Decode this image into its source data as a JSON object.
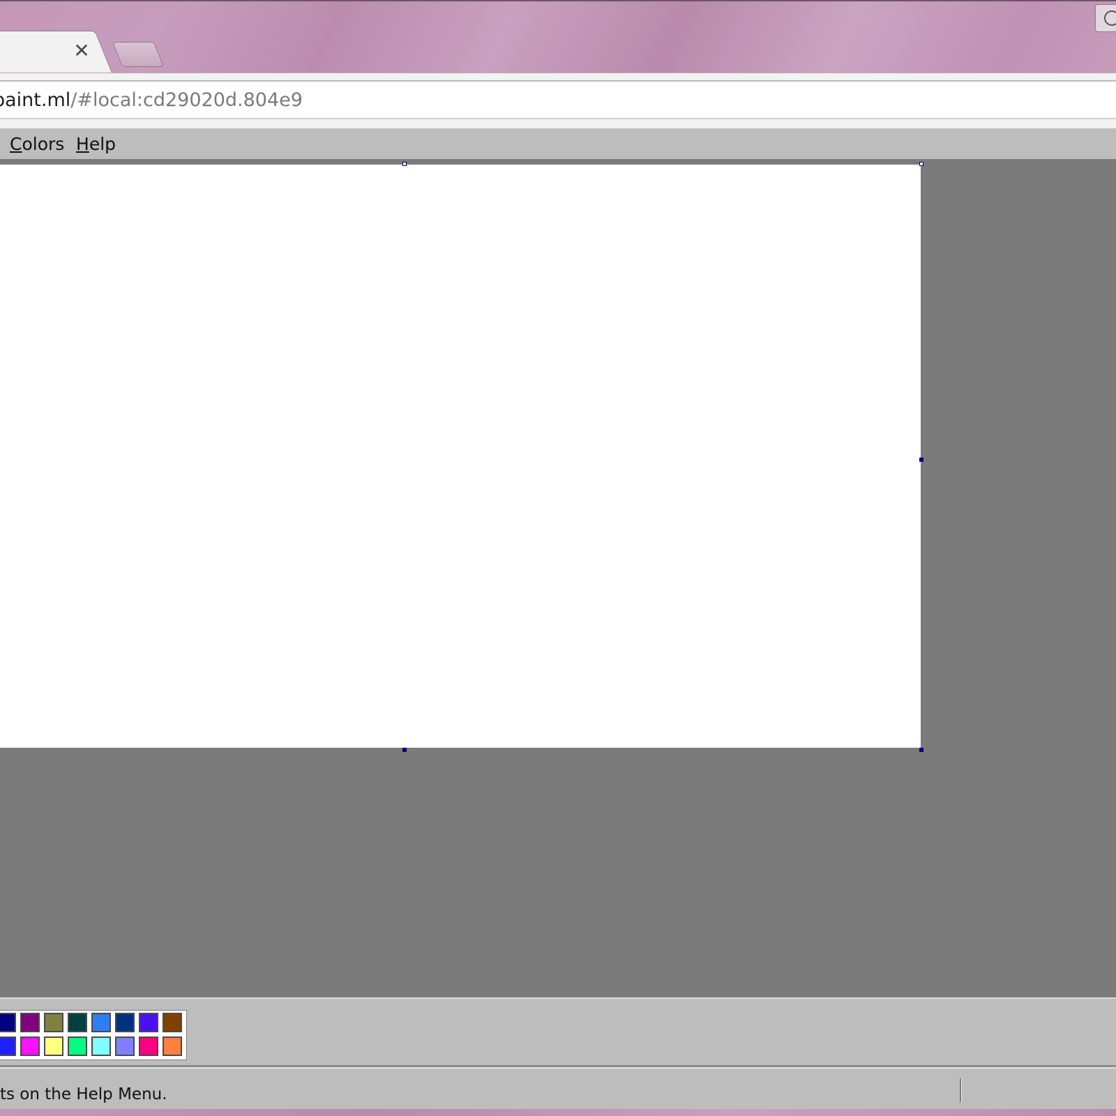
{
  "browser": {
    "url_host": "paint.ml",
    "url_path": "/#local:cd29020d.804e9",
    "tab_close_glyph": "✕"
  },
  "menubar": {
    "colors": {
      "accel": "C",
      "rest": "olors"
    },
    "help": {
      "accel": "H",
      "rest": "elp"
    }
  },
  "palette": {
    "row1": [
      "#000080",
      "#800080",
      "#808040",
      "#004040",
      "#2e7ef2",
      "#003080",
      "#4a10f2",
      "#804000"
    ],
    "row2": [
      "#2020ff",
      "#ff10ff",
      "#ffff80",
      "#00ff80",
      "#80ffff",
      "#8080ff",
      "#ff0080",
      "#ff8040"
    ]
  },
  "status": {
    "text": "ts on the Help Menu."
  }
}
